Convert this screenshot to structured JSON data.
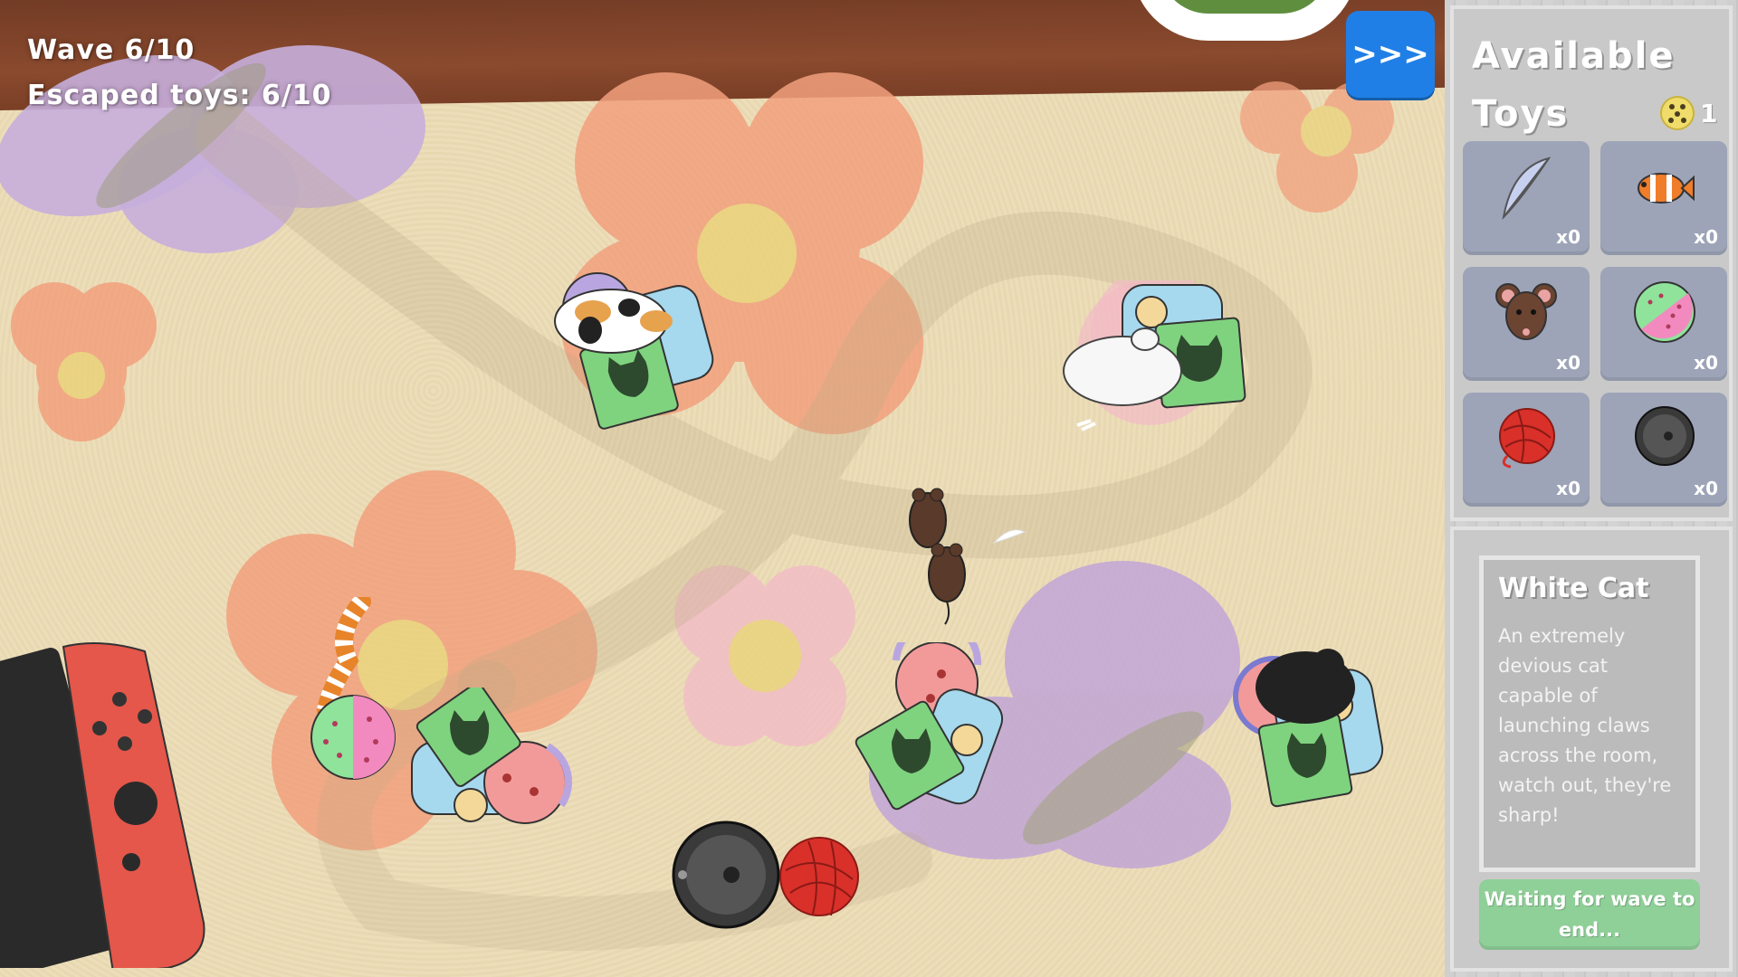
{
  "hud": {
    "wave": "Wave 6/10",
    "escaped": "Escaped toys: 6/10",
    "fast_forward": ">>>"
  },
  "panel": {
    "title": "Available Toys",
    "coins": "1",
    "toys": [
      {
        "name": "feather",
        "quantity": "x0"
      },
      {
        "name": "clownfish",
        "quantity": "x0"
      },
      {
        "name": "mouse",
        "quantity": "x0"
      },
      {
        "name": "spotted-ball",
        "quantity": "x0"
      },
      {
        "name": "yarn-ball",
        "quantity": "x0"
      },
      {
        "name": "robot-vacuum",
        "quantity": "x0"
      }
    ],
    "info": {
      "title": "White Cat",
      "description": "An extremely devious cat capable of launching claws across the room, watch out, they're sharp!",
      "status_button": "Waiting for wave to end..."
    }
  },
  "colors": {
    "rug": "#ecdcb6",
    "flower_orange": "#f2a07d",
    "flower_purple": "#c1a6d6",
    "flower_pink": "#f2bcc6",
    "flower_center": "#ead27a",
    "shelf": "#7a3f26",
    "fast_forward": "#1f7fe6",
    "slot": "#9da4b8",
    "wait_button": "#8fcf98"
  }
}
